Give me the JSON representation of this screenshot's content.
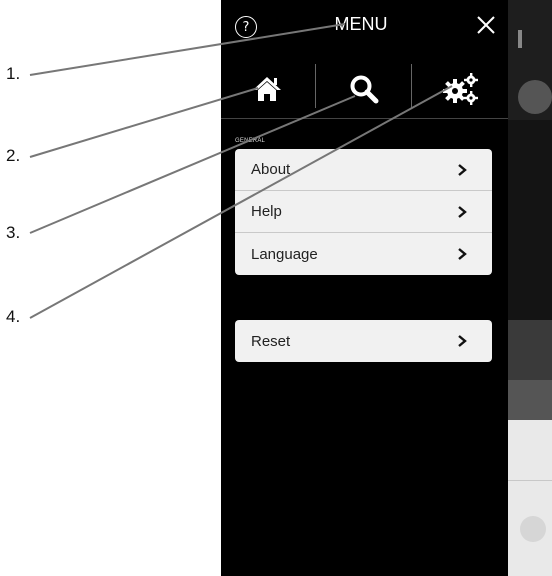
{
  "header": {
    "title": "MENU",
    "help_icon": "question-circle-icon",
    "help_glyph": "?",
    "close_icon": "close-icon"
  },
  "toolbar": {
    "buttons": [
      {
        "icon": "home-icon"
      },
      {
        "icon": "search-icon"
      },
      {
        "icon": "gears-icon"
      }
    ]
  },
  "general": {
    "section_label": "GENERAL",
    "items": [
      {
        "label": "About"
      },
      {
        "label": "Help"
      },
      {
        "label": "Language"
      }
    ]
  },
  "reset": {
    "label": "Reset"
  },
  "callouts": [
    "1.",
    "2.",
    "3.",
    "4."
  ],
  "colors": {
    "panel_bg": "#000000",
    "row_bg": "#f1f1f1",
    "row_text": "#222222",
    "divider": "#c9c9c9"
  }
}
